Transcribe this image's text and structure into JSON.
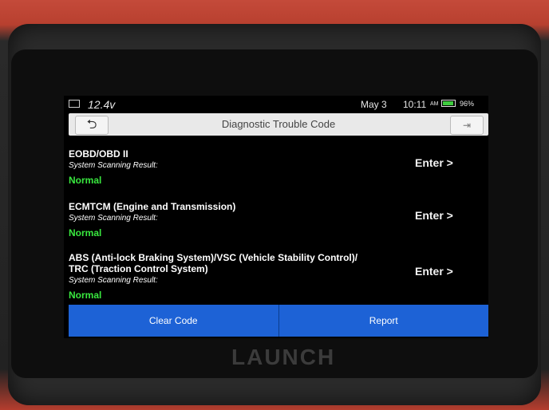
{
  "device": {
    "brand": "LAUNCH"
  },
  "status_bar": {
    "voltage": "12.4v",
    "date": "May 3",
    "time": "10:11",
    "ampm": "AM",
    "battery_percent": "96%",
    "battery_level": 0.96,
    "battery_icon": "battery-icon",
    "car_battery_icon": "car-battery-icon"
  },
  "header": {
    "title": "Diagnostic Trouble Code",
    "back_icon": "back-arrow-icon",
    "exit_icon": "exit-icon"
  },
  "systems": [
    {
      "name": "EOBD/OBD II",
      "scan_label": "System Scanning Result:",
      "status": "Normal",
      "action": "Enter >"
    },
    {
      "name": "ECMTCM (Engine and Transmission)",
      "scan_label": "System Scanning Result:",
      "status": "Normal",
      "action": "Enter >"
    },
    {
      "name_line1": "ABS (Anti-lock Braking System)/VSC (Vehicle Stability Control)/",
      "name_line2": "TRC (Traction Control System)",
      "scan_label": "System Scanning Result:",
      "status": "Normal",
      "action": "Enter >"
    }
  ],
  "footer": {
    "clear_label": "Clear Code",
    "report_label": "Report"
  },
  "colors": {
    "accent": "#1d62d6",
    "status_ok": "#39e83f",
    "device_red": "#c44a3a"
  }
}
